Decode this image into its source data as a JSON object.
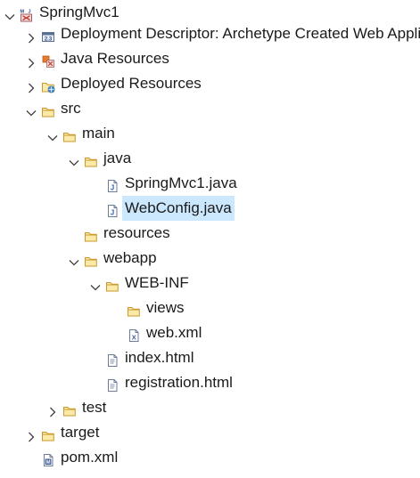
{
  "tree": {
    "nodes": [
      {
        "label": "SpringMvc1",
        "icon": "maven-project-icon",
        "expander": "expanded"
      },
      {
        "label": "Deployment Descriptor: Archetype Created Web Application",
        "icon": "deployment-descriptor-icon",
        "expander": "collapsed"
      },
      {
        "label": "Java Resources",
        "icon": "java-resources-icon",
        "expander": "collapsed"
      },
      {
        "label": "Deployed Resources",
        "icon": "deployed-resources-icon",
        "expander": "collapsed"
      },
      {
        "label": "src",
        "icon": "folder-icon",
        "expander": "expanded"
      },
      {
        "label": "main",
        "icon": "folder-icon",
        "expander": "expanded"
      },
      {
        "label": "java",
        "icon": "folder-icon",
        "expander": "expanded"
      },
      {
        "label": "SpringMvc1.java",
        "icon": "java-file-icon",
        "expander": "none"
      },
      {
        "label": "WebConfig.java",
        "icon": "java-file-icon",
        "expander": "none",
        "selected": true
      },
      {
        "label": "resources",
        "icon": "folder-icon",
        "expander": "none"
      },
      {
        "label": "webapp",
        "icon": "folder-icon",
        "expander": "expanded"
      },
      {
        "label": "WEB-INF",
        "icon": "folder-icon",
        "expander": "expanded"
      },
      {
        "label": "views",
        "icon": "folder-icon",
        "expander": "none"
      },
      {
        "label": "web.xml",
        "icon": "xml-file-icon",
        "expander": "none"
      },
      {
        "label": "index.html",
        "icon": "html-file-icon",
        "expander": "none"
      },
      {
        "label": "registration.html",
        "icon": "html-file-icon",
        "expander": "none"
      },
      {
        "label": "test",
        "icon": "folder-icon",
        "expander": "collapsed"
      },
      {
        "label": "target",
        "icon": "folder-icon",
        "expander": "collapsed"
      },
      {
        "label": "pom.xml",
        "icon": "maven-pom-icon",
        "expander": "none"
      }
    ]
  },
  "colors": {
    "selection_background": "#cce8ff",
    "folder_outline": "#c89a2c",
    "folder_fill": "#fbe9a8",
    "chevron": "#404040"
  }
}
